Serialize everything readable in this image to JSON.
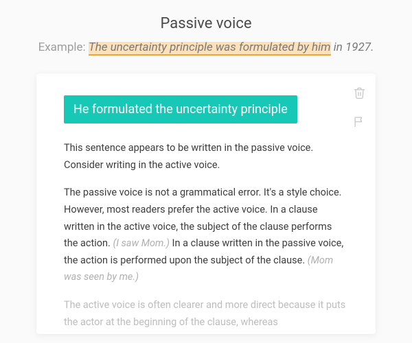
{
  "header": {
    "title": "Passive voice",
    "example_label": "Example: ",
    "example_highlight": "The uncertainty principle was formulated by him",
    "example_tail": " in 1927."
  },
  "card": {
    "suggestion": "He formulated the uncertainty principle",
    "intro_1": "This sentence appears to be written in the passive voice. Consider writing in the active voice.",
    "para2_a": "The passive voice is not a grammatical error. It's a style choice. However, most readers prefer the active voice. In a clause written in the active voice, the subject of the clause performs the action. ",
    "para2_ex1": "(I saw Mom.)",
    "para2_b": " In a clause written in the passive voice, the action is performed upon the subject of the clause. ",
    "para2_ex2": "(Mom was seen by me.)",
    "para3": "The active voice is often clearer and more direct because it puts the actor at the beginning of the clause, whereas"
  },
  "icons": {
    "trash": "trash-icon",
    "flag": "flag-icon"
  }
}
